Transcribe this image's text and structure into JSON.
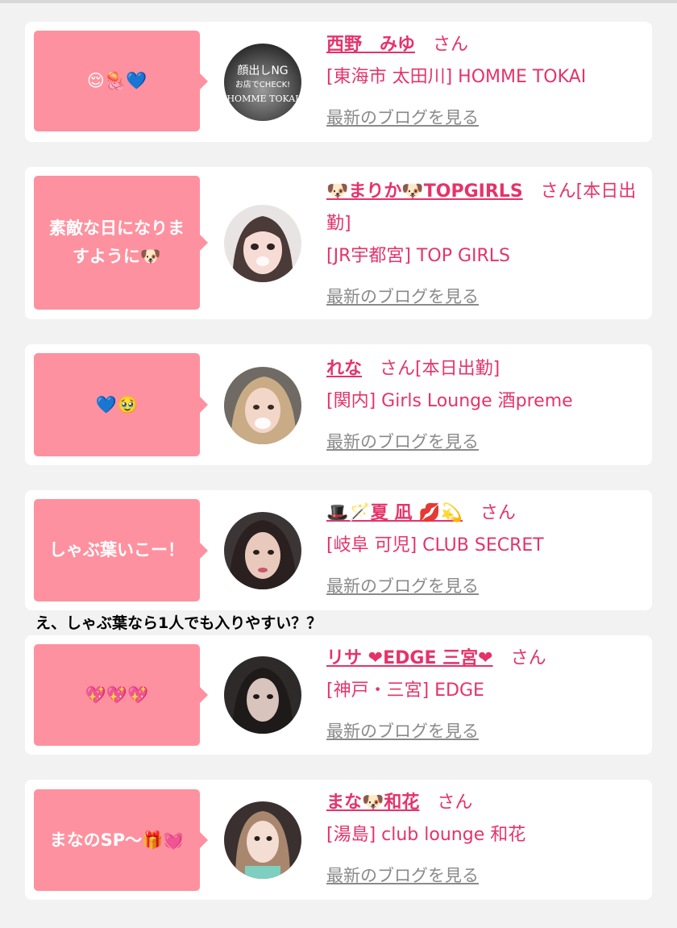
{
  "colors": {
    "accent": "#e5336a",
    "bubble": "#fe919f",
    "link_gray": "#8a8a8a"
  },
  "overlay_comment": "え、しゃぶ葉なら1人でも入りやすい？？",
  "cards": [
    {
      "bubble": "😌🪼💙",
      "name": "西野　みゆ",
      "suffix": "さん",
      "shop": "[東海市 太田川] HOMME TOKAI",
      "blog_link": "最新のブログを見る",
      "avatar_text": [
        "顔出しNG",
        "お店でCHECK!",
        "HOMME TOKAI"
      ]
    },
    {
      "bubble": "素敵な日になりますように🐶",
      "name": "🐶まりか🐶TOPGIRLS",
      "suffix": "さん[本日出勤]",
      "shop": "[JR宇都宮] TOP GIRLS",
      "blog_link": "最新のブログを見る"
    },
    {
      "bubble": "💙🥹",
      "name": "れな",
      "suffix": "さん[本日出勤]",
      "shop": "[関内] Girls Lounge 酒preme",
      "blog_link": "最新のブログを見る"
    },
    {
      "bubble": "しゃぶ葉いこー！",
      "name": "🎩🪄夏 凪 💋💫",
      "suffix": "さん",
      "shop": "[岐阜 可児] CLUB SECRET",
      "blog_link": "最新のブログを見る"
    },
    {
      "bubble": "💖💖💖",
      "name": "リサ ❤EDGE 三宮❤",
      "suffix": "さん",
      "shop": "[神戸・三宮] EDGE",
      "blog_link": "最新のブログを見る"
    },
    {
      "bubble": "まなのSP〜🎁💓",
      "name": "まな🐶和花",
      "suffix": "さん",
      "shop": "[湯島] club lounge 和花",
      "blog_link": "最新のブログを見る"
    }
  ]
}
